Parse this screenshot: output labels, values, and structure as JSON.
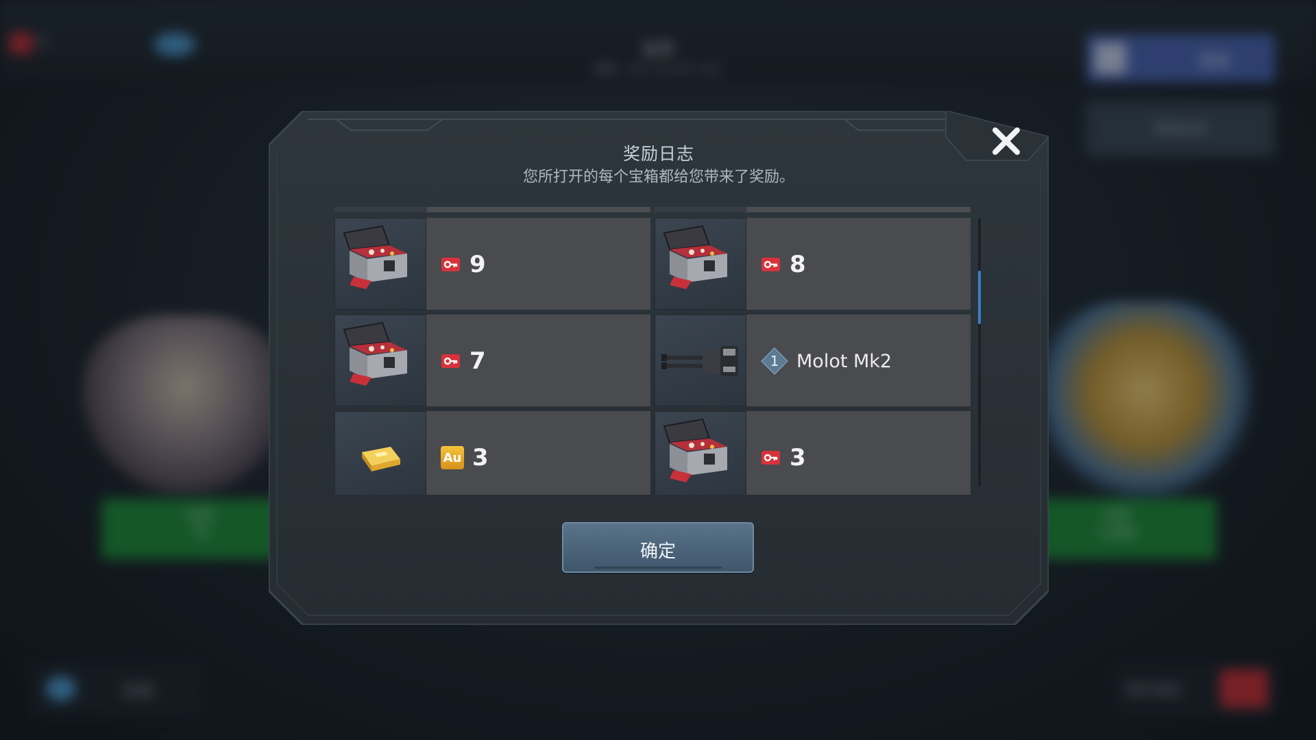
{
  "background": {
    "title": "金库",
    "timer": "刷新: 1天 23小时 14分",
    "resource_value": "5",
    "facebook_button": "登录",
    "second_button": "获取金块",
    "left_open_button": "打开",
    "left_open_cost": "75",
    "right_open_button": "打开",
    "right_open_cost": "1,000",
    "bottom_left_label": "赶紧",
    "bottom_right_label": "特价体验"
  },
  "dialog": {
    "title": "奖励日志",
    "subtitle": "您所打开的每个宝箱都给您带来了奖励。",
    "confirm_button": "确定",
    "close_icon": "close-icon"
  },
  "rewards": [
    {
      "item_icon": "chest-icon",
      "currency_icon": "key-icon",
      "amount": "9"
    },
    {
      "item_icon": "chest-icon",
      "currency_icon": "key-icon",
      "amount": "8"
    },
    {
      "item_icon": "chest-icon",
      "currency_icon": "key-icon",
      "amount": "7"
    },
    {
      "item_icon": "gun-icon",
      "currency_icon": "level-diamond-icon",
      "level": "1",
      "name": "Molot Mk2"
    },
    {
      "item_icon": "gold-bar-icon",
      "currency_icon": "gold-au-icon",
      "currency_label": "Au",
      "amount": "3"
    },
    {
      "item_icon": "chest-icon",
      "currency_icon": "key-icon",
      "amount": "3"
    }
  ],
  "colors": {
    "panel": "#2b3238",
    "cell": "#4a4b4e",
    "button": "#4c6479",
    "key_red": "#d8323b",
    "gold": "#e3a92a",
    "scroll_accent": "#3a7fc2"
  }
}
